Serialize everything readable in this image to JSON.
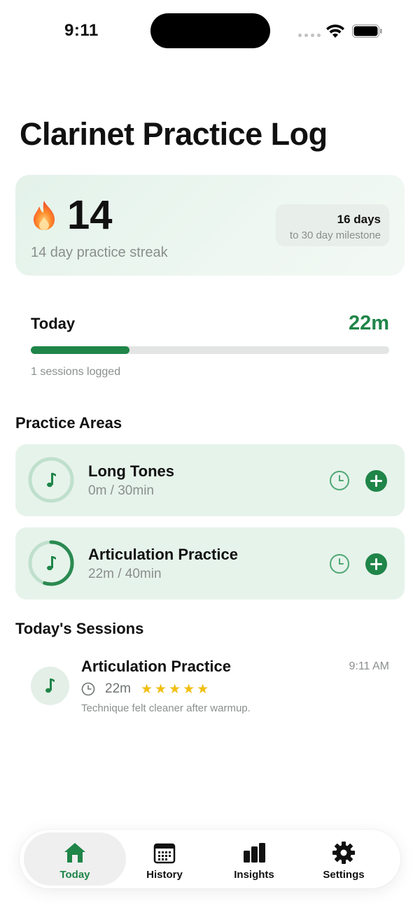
{
  "status_bar": {
    "time": "9:11"
  },
  "header": {
    "title": "Clarinet Practice Log"
  },
  "streak": {
    "icon": "flame-icon",
    "count": "14",
    "label": "14 day practice streak",
    "milestone_days": "16 days",
    "milestone_label": "to 30 day milestone"
  },
  "today": {
    "label": "Today",
    "minutes": "22m",
    "progress_fraction": 0.275,
    "sessions_text": "1 sessions logged"
  },
  "practice_areas": {
    "title": "Practice Areas",
    "items": [
      {
        "name": "Long Tones",
        "progress_text": "0m / 30min",
        "progress_fraction": 0.0
      },
      {
        "name": "Articulation Practice",
        "progress_text": "22m / 40min",
        "progress_fraction": 0.55
      }
    ]
  },
  "sessions": {
    "title": "Today's Sessions",
    "items": [
      {
        "name": "Articulation Practice",
        "time": "9:11 AM",
        "duration": "22m",
        "rating": 5,
        "note": "Technique felt cleaner after warmup."
      }
    ]
  },
  "tabs": [
    {
      "label": "Today",
      "icon": "house-icon",
      "active": true
    },
    {
      "label": "History",
      "icon": "calendar-icon",
      "active": false
    },
    {
      "label": "Insights",
      "icon": "bar-chart-icon",
      "active": false
    },
    {
      "label": "Settings",
      "icon": "gear-icon",
      "active": false
    }
  ],
  "colors": {
    "accent": "#1f8548",
    "card_bg": "#e6f3eb",
    "star": "#f2bf12",
    "muted": "#8a8f8c"
  }
}
